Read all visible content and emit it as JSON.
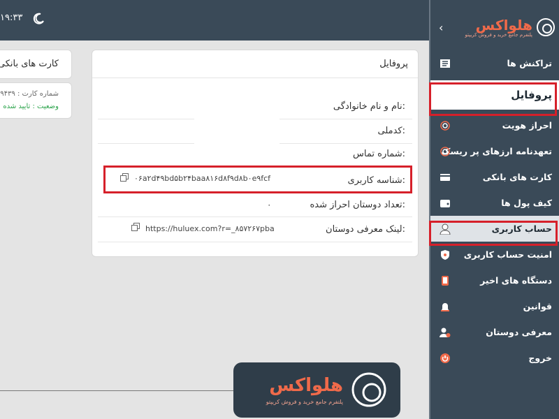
{
  "topbar": {
    "clock": "۱۹:۳۳"
  },
  "sidebar": {
    "logo": {
      "name": "هلواکس",
      "tagline": "پلتفرم جامع خرید و فروش کریپتو"
    },
    "items": [
      {
        "label": "تراکنش ها",
        "icon": "transactions-icon"
      },
      {
        "label": "پروفایل",
        "icon": ""
      },
      {
        "label": "احراز هویت",
        "icon": "fingerprint-icon"
      },
      {
        "label": "تعهدنامه ارزهای پر ریسک",
        "icon": "fingerprint-icon"
      },
      {
        "label": "کارت های بانکی",
        "icon": "bank-card-icon"
      },
      {
        "label": "کیف پول ها",
        "icon": "wallet-icon"
      },
      {
        "label": "حساب کاربری",
        "icon": "user-icon"
      },
      {
        "label": "امنیت حساب کاربری",
        "icon": "shield-icon"
      },
      {
        "label": "دستگاه های اخیر",
        "icon": "phone-icon"
      },
      {
        "label": "قوانین",
        "icon": "alarm-icon"
      },
      {
        "label": "معرفی دوستان",
        "icon": "add-user-icon"
      },
      {
        "label": "خروج",
        "icon": "power-icon"
      }
    ]
  },
  "profile": {
    "title": "پروفایل",
    "full_name_label": "نام و نام خانوادگی:",
    "national_code_label": "کدملی:",
    "phone_label": "شماره تماس:",
    "user_id_label": "شناسه کاربری:",
    "user_id_value": "۰۶a۲d۴۹bd۵b۲۴baa۸۱۶d۸f۹d۸b۰e۹fcf",
    "verified_friends_label": "تعداد دوستان احراز شده:",
    "verified_friends_value": "۰",
    "referral_link_label": "لینک معرفی دوستان:",
    "referral_link_value": "https://huluex.com?r=_۸۵۷۲۶۷pba"
  },
  "bank_cards": {
    "title": "کارت های بانکی",
    "card_number": "شماره کارت : ۹۴۳۹",
    "status": "وضعیت : تایید شده"
  },
  "watermark": {
    "name": "هلواکس",
    "tagline": "پلتفرم جامع خرید و فروش کریپتو"
  },
  "colors": {
    "sidebar": "#3a4a58",
    "brand": "#f06a4a",
    "highlight": "#d6202a",
    "success": "#2aa34a"
  }
}
